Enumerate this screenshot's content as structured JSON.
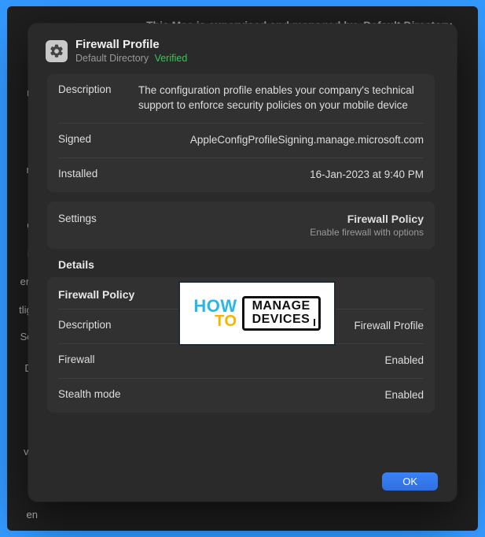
{
  "behind": {
    "banner": "This Mac is supervised and managed by: Default Directory",
    "sidebar_fragments": [
      "ns",
      "ne",
      "ce",
      "ity",
      "entr",
      "tligh",
      "Sec",
      "Do",
      "ver",
      "en"
    ]
  },
  "header": {
    "title": "Firewall Profile",
    "subtitle": "Default Directory",
    "verified": "Verified"
  },
  "info": {
    "description_label": "Description",
    "description_value": "The configuration profile enables your company's technical support to enforce security policies on your mobile device",
    "signed_label": "Signed",
    "signed_value": "AppleConfigProfileSigning.manage.microsoft.com",
    "installed_label": "Installed",
    "installed_value": "16-Jan-2023 at 9:40 PM"
  },
  "settings": {
    "label": "Settings",
    "title": "Firewall Policy",
    "subtitle": "Enable firewall with options"
  },
  "details": {
    "heading": "Details",
    "policy_title": "Firewall Policy",
    "rows": [
      {
        "label": "Description",
        "value": "Firewall Profile"
      },
      {
        "label": "Firewall",
        "value": "Enabled"
      },
      {
        "label": "Stealth mode",
        "value": "Enabled"
      }
    ]
  },
  "footer": {
    "ok": "OK"
  },
  "watermark": {
    "left_line1": "HOW",
    "left_line2": "TO",
    "right_line1": "MANAGE",
    "right_line2": "DEVICES"
  }
}
